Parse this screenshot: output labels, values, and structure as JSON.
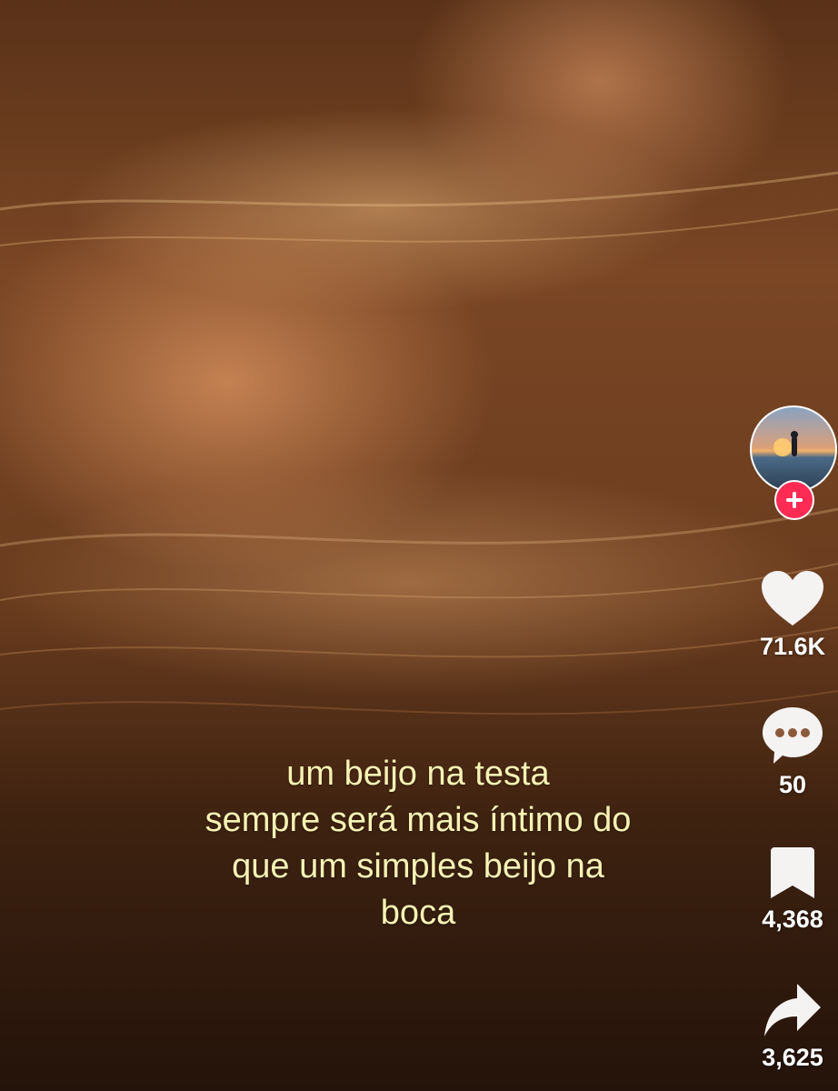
{
  "caption": {
    "lines": [
      "um beijo na testa",
      "sempre será mais íntimo do",
      "que um simples beijo na",
      "boca"
    ]
  },
  "actions": {
    "likes": "71.6K",
    "comments": "50",
    "saves": "4,368",
    "shares": "3,625"
  },
  "icons": {
    "avatar": "avatar",
    "follow": "plus-icon",
    "like": "heart-icon",
    "comment": "comment-bubble-icon",
    "save": "bookmark-icon",
    "share": "share-arrow-icon"
  },
  "colors": {
    "follow_button": "#fe2c55",
    "caption_text": "#f7f2b5",
    "icon_white": "#ffffff"
  }
}
